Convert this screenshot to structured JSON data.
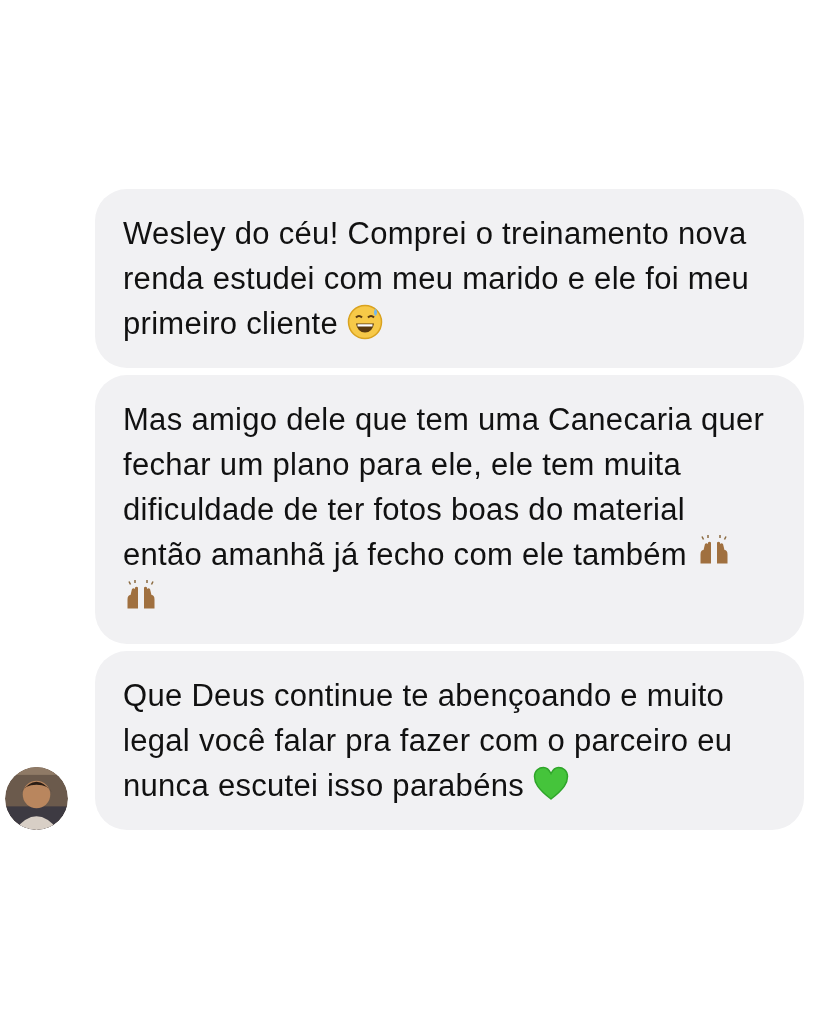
{
  "messages": [
    {
      "text": "Wesley do céu! Comprei o treinamento nova renda estudei com meu marido e ele foi meu primeiro cliente",
      "emojis": [
        {
          "kind": "sweat-smile"
        }
      ]
    },
    {
      "text": "Mas amigo dele que tem uma Canecaria quer fechar um plano para ele, ele tem muita dificuldade de ter fotos boas do material então amanhã já fecho com ele também",
      "emojis": [
        {
          "kind": "raised-hands"
        },
        {
          "kind": "raised-hands"
        }
      ]
    },
    {
      "text": "Que Deus continue te abençoando e muito legal você falar pra fazer com o parceiro eu nunca escutei isso parabéns",
      "emojis": [
        {
          "kind": "green-heart"
        }
      ]
    }
  ]
}
